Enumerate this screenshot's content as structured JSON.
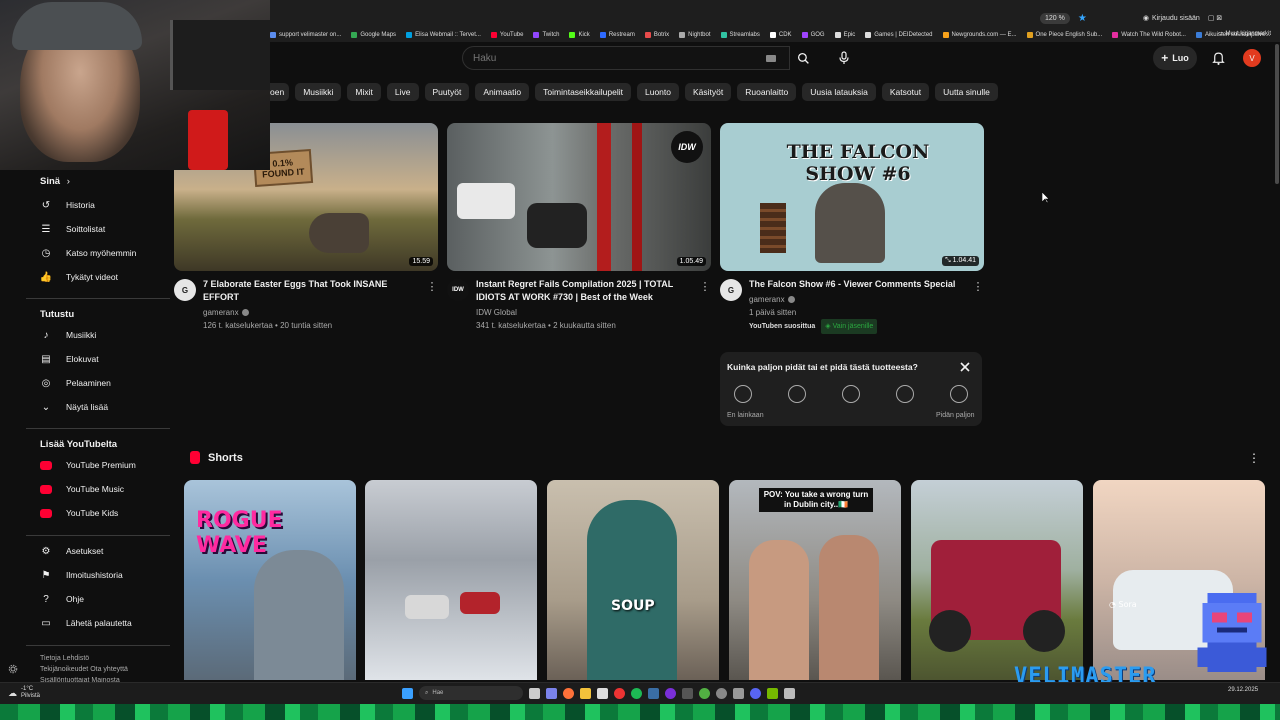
{
  "browser": {
    "zoom": "120 %",
    "signin": "Kirjaudu sisään",
    "bookmarks": [
      {
        "label": "support velimaster on...",
        "color": "#5b8def"
      },
      {
        "label": "Google Maps",
        "color": "#34a853"
      },
      {
        "label": "Elisa Webmail :: Tervet...",
        "color": "#00a0e0"
      },
      {
        "label": "YouTube",
        "color": "#ff0033"
      },
      {
        "label": "Twitch",
        "color": "#9146ff"
      },
      {
        "label": "Kick",
        "color": "#53fc18"
      },
      {
        "label": "Restream",
        "color": "#2f6bff"
      },
      {
        "label": "Botrix",
        "color": "#e84b4b"
      },
      {
        "label": "Nightbot",
        "color": "#aaaaaa"
      },
      {
        "label": "Streamlabs",
        "color": "#31c3a2"
      },
      {
        "label": "CDK",
        "color": "#ffffff"
      },
      {
        "label": "GOG",
        "color": "#a044ff"
      },
      {
        "label": "Epic",
        "color": "#dddddd"
      },
      {
        "label": "Games | DEIDetected",
        "color": "#dddddd"
      },
      {
        "label": "Newgrounds.com — E...",
        "color": "#f7a21b"
      },
      {
        "label": "One Piece English Sub...",
        "color": "#e0a020"
      },
      {
        "label": "Watch The Wild Robot...",
        "color": "#e52ea0"
      },
      {
        "label": "Aikuisten sosiaalipalve...",
        "color": "#3b7dd8"
      }
    ],
    "other_bookmarks": "Muut kirjanmerkit"
  },
  "header": {
    "search_placeholder": "Haku",
    "create_label": "Luo",
    "avatar_letter": "V"
  },
  "chips": [
    "oen",
    "Musiikki",
    "Mixit",
    "Live",
    "Puutyöt",
    "Animaatio",
    "Toimintaseikkailupelit",
    "Luonto",
    "Käsityöt",
    "Ruoanlaitto",
    "Uusia latauksia",
    "Katsotut",
    "Uutta sinulle"
  ],
  "sidebar": {
    "you_heading": "Sinä",
    "you_items": [
      "Historia",
      "Soittolistat",
      "Katso myöhemmin",
      "Tykätyt videot"
    ],
    "explore_heading": "Tutustu",
    "explore_items": [
      "Musiikki",
      "Elokuvat",
      "Pelaaminen",
      "Näytä lisää"
    ],
    "more_heading": "Lisää YouTubelta",
    "more_items": [
      "YouTube Premium",
      "YouTube Music",
      "YouTube Kids"
    ],
    "settings_items": [
      "Asetukset",
      "Ilmoitushistoria",
      "Ohje",
      "Lähetä palautetta"
    ],
    "footer_line1": "Tietoja  Lehdistö",
    "footer_line2": "Tekijänoikeudet  Ota yhteyttä",
    "footer_line3": "Sisällöntuottajat  Mainosta"
  },
  "videos": [
    {
      "title": "7 Elaborate Easter Eggs That Took INSANE EFFORT",
      "channel": "gameranx",
      "stats": "126 t. katselukertaa • 20 tuntia sitten",
      "duration": "15.59",
      "thumb_text": "0.1% FOUND IT"
    },
    {
      "title": "Instant Regret Fails Compilation 2025 | TOTAL IDIOTS AT WORK #730 | Best of the Week",
      "channel": "IDW Global",
      "stats": "341 t. katselukertaa • 2 kuukautta sitten",
      "duration": "1.05.49",
      "thumb_text": "IDW"
    },
    {
      "title": "The Falcon Show #6 - Viewer Comments Special",
      "channel": "gameranx",
      "stats": "1 päivä sitten",
      "duration": "1.04.41",
      "thumb_text": "THE FALCON SHOW #6",
      "badge_recommended": "YouTuben suosittua",
      "badge_members": "Vain jäsenille"
    }
  ],
  "survey": {
    "question": "Kuinka paljon pidät tai et pidä tästä tuotteesta?",
    "low_label": "En lainkaan",
    "high_label": "Pidän paljon"
  },
  "shorts": {
    "heading": "Shorts",
    "items": [
      {
        "overlay": "ROGUE WAVE"
      },
      {
        "overlay": ""
      },
      {
        "overlay": "SOUP"
      },
      {
        "overlay": "POV: You take a wrong turn in Dublin city..🇮🇪"
      },
      {
        "overlay": ""
      },
      {
        "overlay": "Sora"
      }
    ]
  },
  "taskbar": {
    "weather_temp": "-1°C",
    "weather_desc": "Pilvistä",
    "search_label": "Hae",
    "date": "29.12.2025"
  },
  "overlay": {
    "brand": "VELIMASTER"
  },
  "colors": {
    "background": "#0f0f0f",
    "accent_red": "#ff0033",
    "avatar": "#e23b1f",
    "members_green": "#2ba640"
  }
}
